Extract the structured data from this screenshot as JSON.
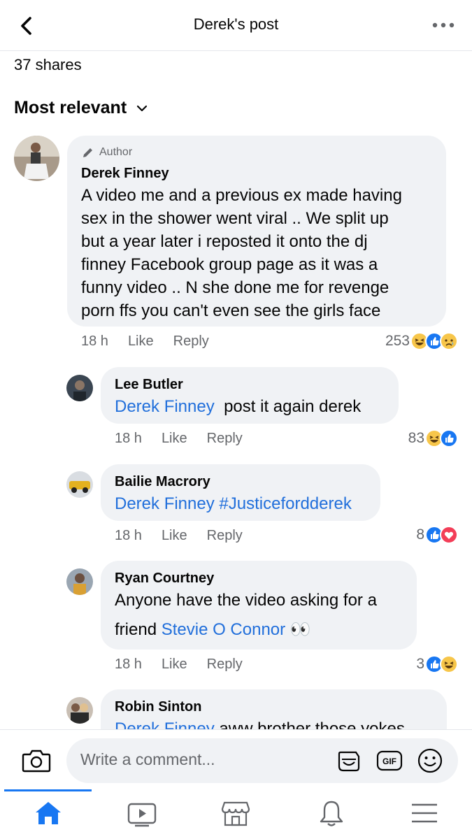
{
  "header": {
    "title": "Derek's post"
  },
  "shares": "37 shares",
  "sort": {
    "label": "Most relevant"
  },
  "comments": [
    {
      "badge": "Author",
      "name": "Derek Finney",
      "text_lines": [
        "A video me and a previous ex made having",
        "sex in the shower went viral .. We split up",
        "but a year later i reposted it onto the dj",
        "finney Facebook group page as it was a",
        "funny video .. N she done me for revenge",
        "porn ffs you can't even see the girls face"
      ],
      "time": "18 h",
      "like": "Like",
      "reply": "Reply",
      "reaction_count": "253",
      "reactions": [
        "haha",
        "like",
        "sad"
      ]
    },
    {
      "name": "Lee Butler",
      "mention": "Derek Finney",
      "text": "post it again derek",
      "time": "18 h",
      "like": "Like",
      "reply": "Reply",
      "reaction_count": "83",
      "reactions": [
        "haha",
        "like"
      ]
    },
    {
      "name": "Bailie Macrory",
      "mention": "Derek Finney",
      "hashtag": "#Justicefordderek",
      "time": "18 h",
      "like": "Like",
      "reply": "Reply",
      "reaction_count": "8",
      "reactions": [
        "like",
        "love"
      ]
    },
    {
      "name": "Ryan Courtney",
      "line1": "Anyone have the video asking for a",
      "line2_prefix": "friend",
      "mention": "Stevie O Connor",
      "emoji": "👀",
      "time": "18 h",
      "like": "Like",
      "reply": "Reply",
      "reaction_count": "3",
      "reactions": [
        "like",
        "haha"
      ]
    },
    {
      "name": "Robin Sinton",
      "mention": "Derek Finney",
      "text": "aww brother those yokes"
    }
  ],
  "composer": {
    "placeholder": "Write a comment...",
    "gif_label": "GIF"
  },
  "colors": {
    "accent": "#1877f2",
    "mention": "#216fdb",
    "bubble": "#f0f2f5",
    "muted": "#65676b"
  },
  "tabs": [
    "home-icon",
    "watch-icon",
    "marketplace-icon",
    "notifications-icon",
    "menu-icon"
  ]
}
